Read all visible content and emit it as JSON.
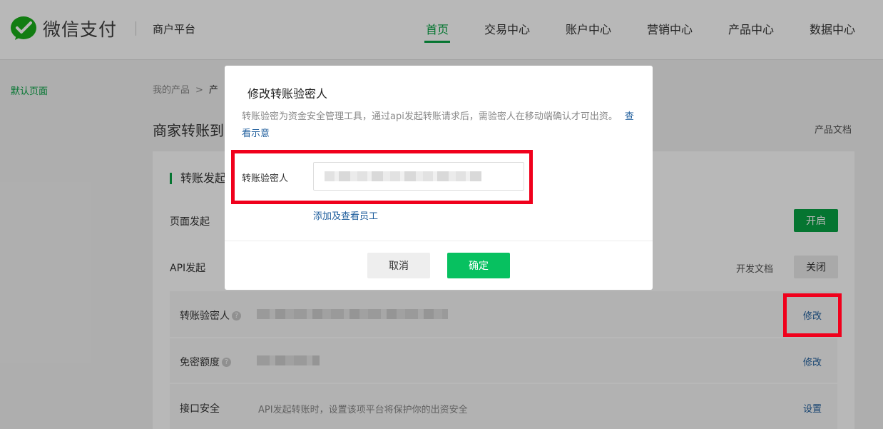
{
  "header": {
    "logo_text": "微信支付",
    "platform": "商户平台",
    "nav": [
      "首页",
      "交易中心",
      "账户中心",
      "营销中心",
      "产品中心",
      "数据中心"
    ],
    "active_nav_index": 0
  },
  "left_nav": {
    "item": "默认页面"
  },
  "breadcrumb": {
    "root": "我的产品",
    "separator": ">",
    "current": "产"
  },
  "page": {
    "title": "商家转账到",
    "doc_link": "产品文档"
  },
  "card": {
    "section_title": "转账发起",
    "page_launch": {
      "label": "页面发起",
      "button": "开启"
    },
    "api_launch": {
      "label": "API发起",
      "doc_link": "开发文档",
      "button": "关闭"
    },
    "verifier": {
      "label": "转账验密人",
      "help": "?",
      "action": "修改"
    },
    "free_limit": {
      "label": "免密额度",
      "help": "?",
      "action": "修改"
    },
    "api_security": {
      "label": "接口安全",
      "desc": "API发起转账时，设置该项平台将保护你的出资安全",
      "action": "设置"
    }
  },
  "dialog": {
    "title": "修改转账验密人",
    "desc": "转账验密为资金安全管理工具，通过api发起转账请求后，需验密人在移动端确认才可出资。",
    "desc_link": "查看示意",
    "field_label": "转账验密人",
    "field_value": "",
    "add_staff_link": "添加及查看员工",
    "cancel": "取消",
    "confirm": "确定"
  },
  "colors": {
    "brand_green": "#07a344",
    "confirm_green": "#07c160",
    "link_blue": "#1e5d9c",
    "annotation_red": "#f0001c"
  }
}
